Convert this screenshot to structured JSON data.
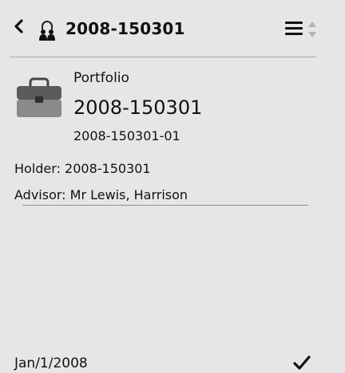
{
  "header": {
    "title": "2008-150301",
    "back_icon": "chevron-left-icon",
    "lock_icon": "lock-people-icon",
    "menu_icon": "hamburger-menu-icon",
    "sort_icon": "sort-arrows-icon"
  },
  "record": {
    "icon": "briefcase-icon",
    "kind": "Portfolio",
    "title": "2008-150301",
    "sub_id": "2008-150301-01",
    "holder": "Holder: 2008-150301",
    "advisor": "Advisor: Mr Lewis, Harrison"
  },
  "footer": {
    "date": "Jan/1/2008",
    "check_icon": "checkmark-icon"
  }
}
